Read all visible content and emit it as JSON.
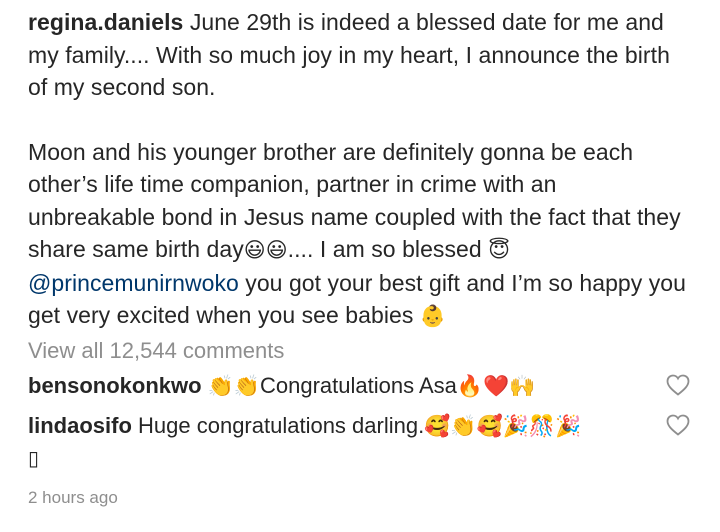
{
  "post": {
    "username": "regina.daniels",
    "para1": "June 29th is indeed a blessed date for me and my family.... With so much joy in my heart, I announce the birth of my second son.",
    "para2_a": "Moon and his younger brother are definitely gonna be each other’s life time companion, partner in crime with an unbreakable bond in Jesus name coupled with the fact that they share same birth day",
    "para2_emoji1": "😃😃",
    "para2_b": ".... I am so blessed ",
    "para2_emoji2": "😇",
    "mention": "@princemunirnwoko",
    "para2_c": " you got your best gift and I’m so happy you get very excited when you see babies ",
    "para2_emoji3": "👶"
  },
  "view_all": "View all 12,544 comments",
  "comments": [
    {
      "username": "bensonokonkwo",
      "pre_emoji": "👏👏",
      "text": "Congratulations Asa",
      "post_emoji": "🔥❤️🙌"
    },
    {
      "username": "lindaosifo",
      "text": "Huge congratulations darling.",
      "post_emoji": "🥰👏🥰🎉🎊🎉",
      "continuation": "▯"
    }
  ],
  "timestamp": "2 hours ago",
  "icons": {
    "like": "heart-outline-icon"
  }
}
